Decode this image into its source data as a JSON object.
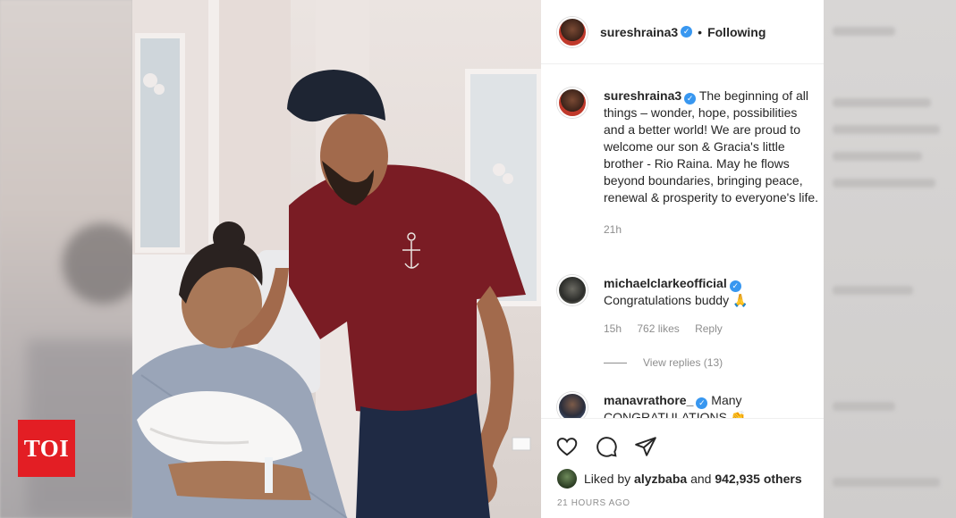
{
  "logo": {
    "text": "TOI"
  },
  "post": {
    "author": "sureshraina3",
    "separator": "•",
    "follow_status": "Following",
    "caption_author": "sureshraina3",
    "caption": "The beginning of all things – wonder, hope, possibilities and a better world! We are proud to welcome our son & Gracia's little brother - Rio Raina. May he flows beyond boundaries, bringing peace, renewal & prosperity to everyone's life.",
    "caption_time": "21h"
  },
  "comments": [
    {
      "user": "michaelclarkeofficial",
      "text": "Congratulations buddy 🙏",
      "time": "15h",
      "likes": "762 likes",
      "reply": "Reply",
      "view_replies": "View replies (13)"
    },
    {
      "user": "manavrathore_",
      "text": "Many CONGRATULATIONS 👏"
    }
  ],
  "footer": {
    "liked_by_prefix": "Liked by",
    "liked_by_user": "alyzbaba",
    "liked_by_and": "and",
    "liked_by_others": "942,935 others",
    "timestamp": "21 HOURS AGO"
  },
  "icons": {
    "like": "heart-icon",
    "comment": "comment-icon",
    "share": "share-icon",
    "verified": "verified-badge-icon"
  },
  "colors": {
    "verified": "#3897f0",
    "logo_red": "#e31e24",
    "muted": "#8e8e8e"
  }
}
